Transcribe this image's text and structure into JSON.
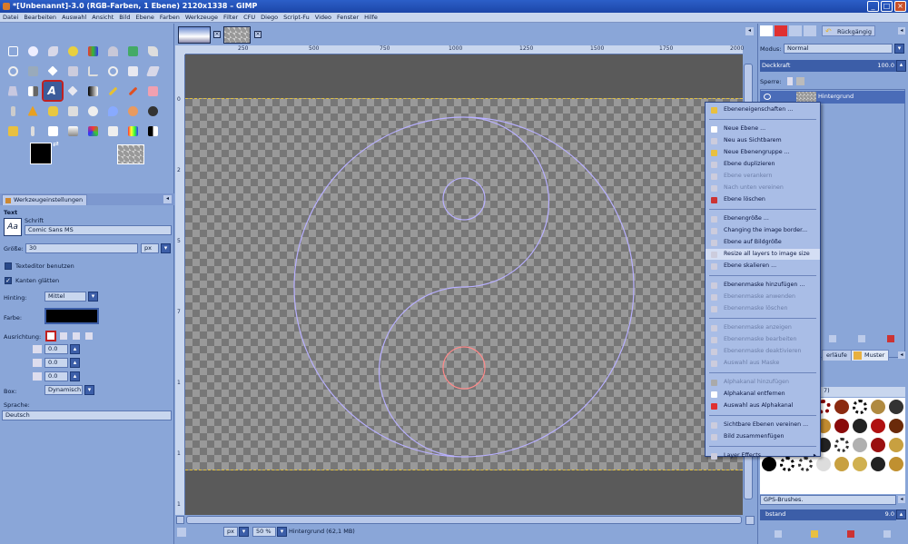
{
  "window": {
    "title": "*[Unbenannt]-3.0 (RGB-Farben, 1 Ebene) 2120x1338 – GIMP"
  },
  "menubar": [
    "Datei",
    "Bearbeiten",
    "Auswahl",
    "Ansicht",
    "Bild",
    "Ebene",
    "Farben",
    "Werkzeuge",
    "Filter",
    "CFU",
    "Diego",
    "Script-Fu",
    "Video",
    "Fenster",
    "Hilfe"
  ],
  "tool_options": {
    "tab_label": "Werkzeugeinstellungen",
    "section": "Text",
    "font_label": "Schrift",
    "font_value": "Comic Sans MS",
    "size_label": "Größe:",
    "size_value": "30",
    "size_unit": "px",
    "texteditor_label": "Texteditor benutzen",
    "antialias_label": "Kanten glätten",
    "hinting_label": "Hinting:",
    "hinting_value": "Mittel",
    "color_label": "Farbe:",
    "justify_label": "Ausrichtung:",
    "indent_value": "0.0",
    "line_spacing_value": "0.0",
    "letter_spacing_value": "0.0",
    "box_label": "Box:",
    "box_value": "Dynamisch",
    "language_label": "Sprache:",
    "language_value": "Deutsch"
  },
  "rulers": {
    "top": [
      "250",
      "500",
      "750",
      "1000",
      "1250",
      "1500",
      "1750",
      "2000"
    ],
    "left": [
      "0",
      "2",
      "5",
      "7",
      "1",
      "1",
      "1"
    ]
  },
  "status": {
    "unit": "px",
    "zoom": "50 %",
    "info": "Hintergrund (62,1 MB)"
  },
  "layers": {
    "mode_label": "Modus:",
    "mode_value": "Normal",
    "opacity_label": "Deckkraft",
    "opacity_value": "100.0",
    "lock_label": "Sperre:",
    "layer_name": "Hintergrund",
    "undo_label": "Rückgängig"
  },
  "brushes": {
    "tab_gradients": "erläufe",
    "tab_patterns": "Muster",
    "header": "7)",
    "name": "GPS-Brushes.",
    "spacing_label": "bstand",
    "spacing_value": "9.0"
  },
  "context_menu": [
    {
      "label": "Ebeneneigenschaften ...",
      "state": "normal"
    },
    {
      "label": "Neue Ebene ...",
      "state": "normal"
    },
    {
      "label": "Neu aus Sichtbarem",
      "state": "normal"
    },
    {
      "label": "Neue Ebenengruppe ...",
      "state": "normal"
    },
    {
      "label": "Ebene duplizieren",
      "state": "normal"
    },
    {
      "label": "Ebene verankern",
      "state": "disabled"
    },
    {
      "label": "Nach unten vereinen",
      "state": "disabled"
    },
    {
      "label": "Ebene löschen",
      "state": "normal"
    },
    {
      "label": "Ebenengröße ...",
      "state": "normal"
    },
    {
      "label": "Changing the image border...",
      "state": "normal"
    },
    {
      "label": "Ebene auf Bildgröße",
      "state": "normal"
    },
    {
      "label": "Resize all layers to image size",
      "state": "highlight"
    },
    {
      "label": "Ebene skalieren ...",
      "state": "normal"
    },
    {
      "label": "Ebenenmaske hinzufügen ...",
      "state": "normal"
    },
    {
      "label": "Ebenenmaske anwenden",
      "state": "disabled"
    },
    {
      "label": "Ebenenmaske löschen",
      "state": "disabled"
    },
    {
      "label": "Ebenenmaske anzeigen",
      "state": "disabled"
    },
    {
      "label": "Ebenenmaske bearbeiten",
      "state": "disabled"
    },
    {
      "label": "Ebenenmaske deaktivieren",
      "state": "disabled"
    },
    {
      "label": "Auswahl aus Maske",
      "state": "disabled"
    },
    {
      "label": "Alphakanal hinzufügen",
      "state": "disabled"
    },
    {
      "label": "Alphakanal entfernen",
      "state": "normal"
    },
    {
      "label": "Auswahl aus Alphakanal",
      "state": "normal"
    },
    {
      "label": "Sichtbare Ebenen vereinen ...",
      "state": "normal"
    },
    {
      "label": "Bild zusammenfügen",
      "state": "normal"
    },
    {
      "label": "Layer Effects",
      "state": "normal"
    }
  ]
}
